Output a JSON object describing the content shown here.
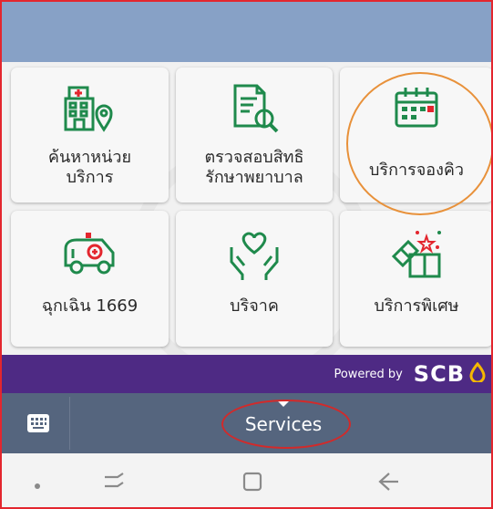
{
  "tiles": [
    {
      "label": "ค้นหาหน่วย\nบริการ",
      "icon": "hospital-location-icon"
    },
    {
      "label": "ตรวจสอบสิทธิ\nรักษาพยาบาล",
      "icon": "document-search-icon"
    },
    {
      "label": "บริการจองคิว",
      "icon": "calendar-icon"
    },
    {
      "label": "ฉุกเฉิน 1669",
      "icon": "ambulance-icon"
    },
    {
      "label": "บริจาค",
      "icon": "hands-heart-icon"
    },
    {
      "label": "บริการพิเศษ",
      "icon": "gift-icon"
    }
  ],
  "powered": {
    "text": "Powered by",
    "brand": "SCB"
  },
  "services": {
    "label": "Services"
  },
  "colors": {
    "header": "#87a1c6",
    "accent_green": "#1f8a4c",
    "purple": "#4e2a84",
    "bar": "#55657e",
    "highlight_orange": "#e8913a",
    "highlight_red": "#d22a2a"
  }
}
